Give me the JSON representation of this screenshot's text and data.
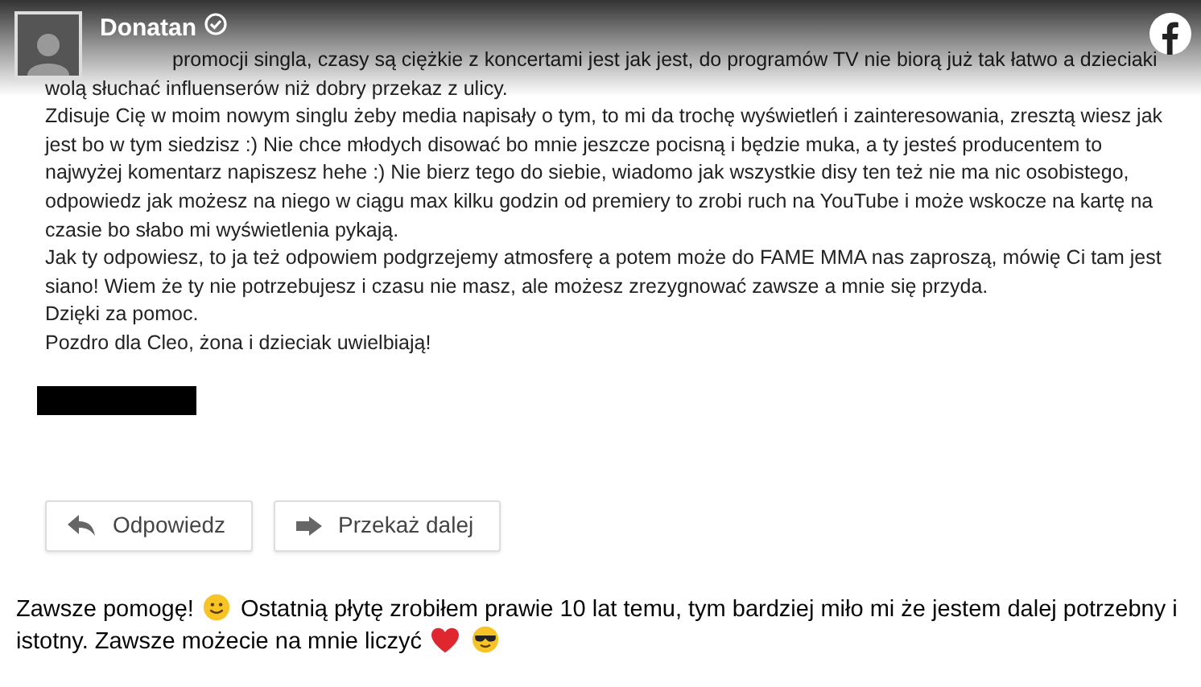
{
  "header": {
    "author": "Donatan",
    "verified": true
  },
  "email": {
    "paragraphs": [
      "promocji singla, czasy są ciężkie z koncertami jest jak jest, do programów TV nie biorą już tak łatwo a dzieciaki wolą słuchać influenserów niż dobry przekaz z ulicy.",
      "Zdisuje Cię w moim nowym singlu żeby media napisały o tym, to mi da trochę wyświetleń i zainteresowania, zresztą wiesz jak jest bo w tym siedzisz :) Nie chce młodych disować bo mnie jeszcze pocisną i będzie muka, a ty jesteś producentem to najwyżej komentarz napiszesz hehe :) Nie bierz tego do siebie, wiadomo jak wszystkie disy ten też nie ma nic osobistego, odpowiedz jak możesz na niego w ciągu max kilku godzin od premiery to zrobi ruch na YouTube i może wskocze na kartę na czasie bo słabo mi wyświetlenia pykają.",
      "Jak ty odpowiesz, to ja też odpowiem podgrzejemy atmosferę a potem może do FAME MMA nas zaproszą, mówię Ci tam jest siano! Wiem że ty nie potrzebujesz i czasu nie masz, ale możesz zrezygnować zawsze a mnie się przyda.",
      "Dzięki za pomoc.",
      "Pozdro dla Cleo, żona i dzieciak uwielbiają!"
    ],
    "buttons": [
      {
        "kind": "reply",
        "label": "Odpowiedz"
      },
      {
        "kind": "forward",
        "label": "Przekaż dalej"
      }
    ]
  },
  "caption": [
    {
      "kind": "text",
      "text": "Zawsze pomogę!"
    },
    {
      "kind": "smile"
    },
    {
      "kind": "text",
      "text": "Ostatnią płytę zrobiłem prawie 10 lat temu, tym bardziej miło mi że jestem dalej potrzebny i"
    },
    {
      "kind": "newline"
    },
    {
      "kind": "text",
      "text": "istotny. Zawsze możecie na mnie liczyć"
    },
    {
      "kind": "heart"
    },
    {
      "kind": "cool"
    }
  ]
}
